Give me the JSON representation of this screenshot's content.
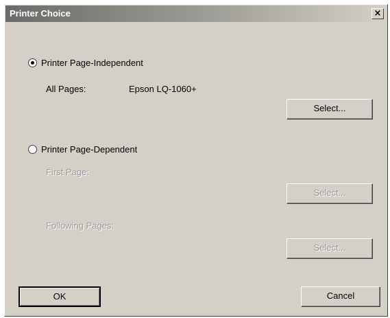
{
  "window": {
    "title": "Printer Choice",
    "close_label": "×"
  },
  "independent": {
    "radio_label": "Printer Page-Independent",
    "all_pages_label": "All Pages:",
    "all_pages_value": "Epson LQ-1060+",
    "select_label": "Select...",
    "checked": true
  },
  "dependent": {
    "radio_label": "Printer Page-Dependent",
    "first_page_label": "First Page:",
    "first_select_label": "Select...",
    "following_pages_label": "Following Pages:",
    "following_select_label": "Select...",
    "checked": false
  },
  "footer": {
    "ok_label": "OK",
    "cancel_label": "Cancel"
  }
}
